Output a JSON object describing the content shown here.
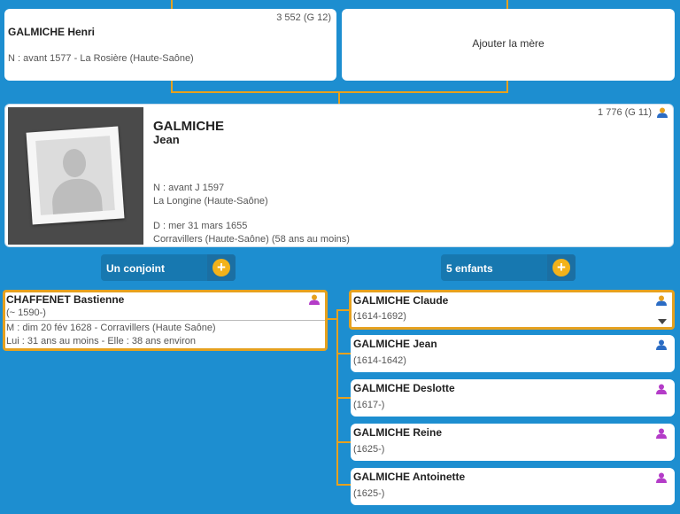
{
  "father": {
    "sosa": "3 552 (G 12)",
    "name": "GALMICHE Henri",
    "birth": "N : avant 1577 - La Rosière (Haute-Saône)"
  },
  "mother": {
    "add_label": "Ajouter la mère"
  },
  "main": {
    "sosa": "1 776 (G 11)",
    "surname": "GALMICHE",
    "firstname": "Jean",
    "birth_line1": "N : avant J 1597",
    "birth_line2": "La Longine (Haute-Saône)",
    "death_line1": "D : mer 31 mars 1655",
    "death_line2": "Corravillers (Haute-Saône) (58 ans au moins)"
  },
  "spouse_button": {
    "label": "Un conjoint"
  },
  "children_button": {
    "label": "5 enfants"
  },
  "spouse": {
    "name": "CHAFFENET Bastienne",
    "dates": "(~ 1590-)",
    "marriage": "M : dim 20 fév 1628 - Corravillers (Haute Saône)",
    "ages": "Lui : 31 ans au moins - Elle : 38 ans environ"
  },
  "children": [
    {
      "name": "GALMICHE Claude",
      "dates": "(1614-1692)",
      "icon": "user-gold-icon"
    },
    {
      "name": "GALMICHE Jean",
      "dates": "(1614-1642)",
      "icon": "user-male-icon"
    },
    {
      "name": "GALMICHE Deslotte",
      "dates": "(1617-)",
      "icon": "user-female-icon"
    },
    {
      "name": "GALMICHE Reine",
      "dates": "(1625-)",
      "icon": "user-female-icon"
    },
    {
      "name": "GALMICHE Antoinette",
      "dates": "(1625-)",
      "icon": "user-female-icon"
    }
  ],
  "colors": {
    "background": "#1d8ed0",
    "connector": "#e6a11e",
    "male": "#2b6cc4",
    "female": "#b43cc8",
    "gold": "#e6a11e"
  }
}
